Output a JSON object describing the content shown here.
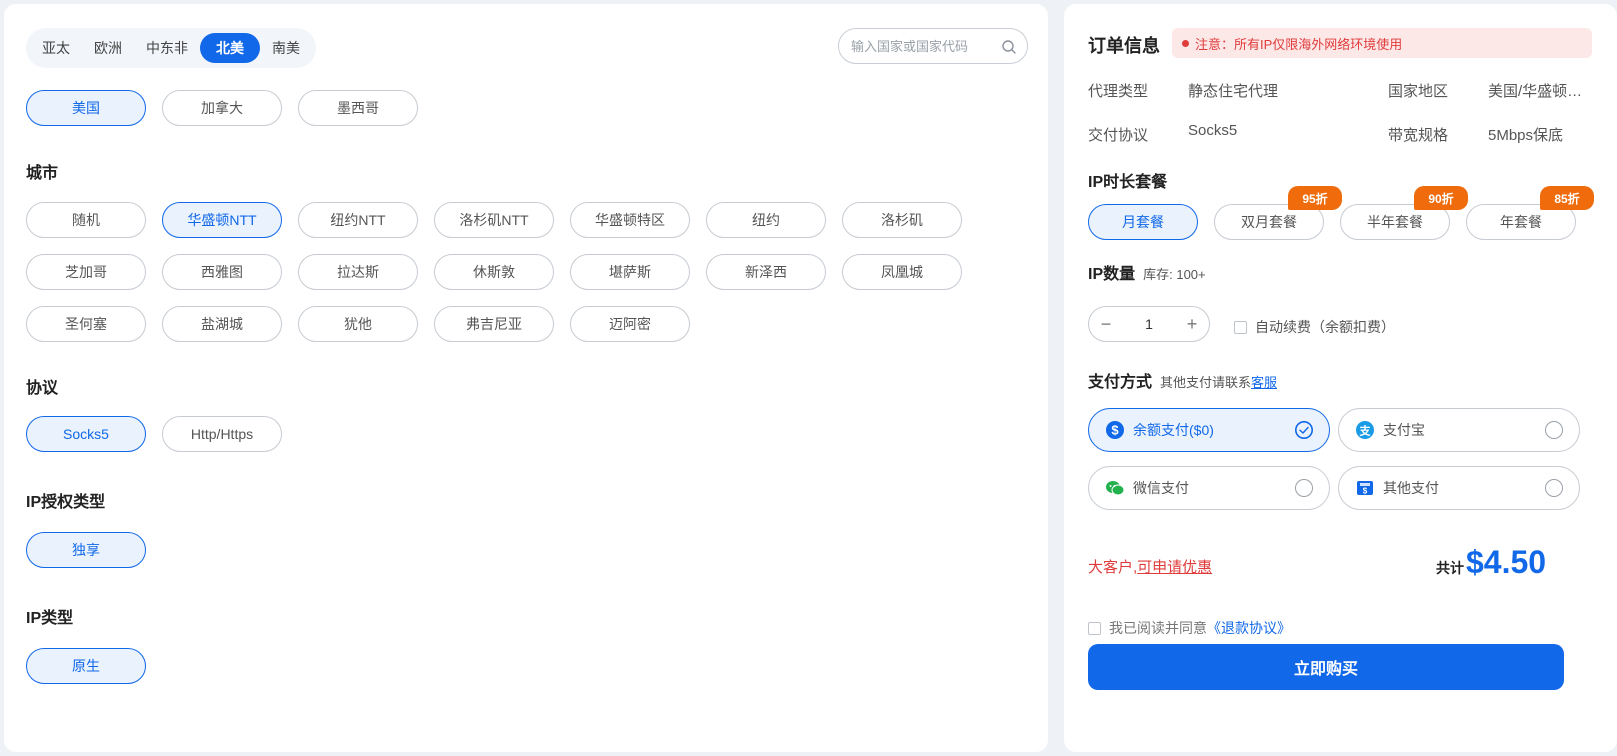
{
  "regions": [
    "亚太",
    "欧洲",
    "中东非",
    "北美",
    "南美"
  ],
  "search": {
    "placeholder": "输入国家或国家代码"
  },
  "countries": [
    "美国",
    "加拿大",
    "墨西哥"
  ],
  "city": {
    "title": "城市",
    "row1": [
      "随机",
      "华盛顿NTT",
      "纽约NTT",
      "洛杉矶NTT",
      "华盛顿特区",
      "纽约",
      "洛杉矶"
    ],
    "row2": [
      "芝加哥",
      "西雅图",
      "拉达斯",
      "休斯敦",
      "堪萨斯",
      "新泽西",
      "凤凰城"
    ],
    "row3": [
      "圣何塞",
      "盐湖城",
      "犹他",
      "弗吉尼亚",
      "迈阿密"
    ]
  },
  "protocol": {
    "title": "协议",
    "options": [
      "Socks5",
      "Http/Https"
    ]
  },
  "auth": {
    "title": "IP授权类型",
    "options": [
      "独享"
    ]
  },
  "iptype": {
    "title": "IP类型",
    "options": [
      "原生"
    ]
  },
  "order": {
    "title": "订单信息",
    "notice": "注意：所有IP仅限海外网络环境使用",
    "proxy_type_label": "代理类型",
    "proxy_type_value": "静态住宅代理",
    "region_label": "国家地区",
    "region_value": "美国/华盛顿NTT",
    "delivery_label": "交付协议",
    "delivery_value": "Socks5",
    "bandwidth_label": "带宽规格",
    "bandwidth_value": "5Mbps保底"
  },
  "packages": {
    "title": "IP时长套餐",
    "items": [
      {
        "label": "月套餐",
        "badge": ""
      },
      {
        "label": "双月套餐",
        "badge": "95折"
      },
      {
        "label": "半年套餐",
        "badge": "90折"
      },
      {
        "label": "年套餐",
        "badge": "85折"
      }
    ]
  },
  "quantity": {
    "title": "IP数量",
    "stock": "库存: 100+",
    "value": "1",
    "minus": "−",
    "plus": "+",
    "auto_renew": "自动续费（余额扣费）"
  },
  "payment": {
    "title": "支付方式",
    "note": "其他支付请联系",
    "contact": "客服",
    "methods": [
      "余额支付($0)",
      "支付宝",
      "微信支付",
      "其他支付"
    ]
  },
  "promo": {
    "prefix": "大客户,",
    "link": "可申请优惠"
  },
  "total": {
    "label": "共计",
    "amount": "$4.50"
  },
  "agree": {
    "text": "我已阅读并同意",
    "link": "《退款协议》"
  },
  "buy_button": "立即购买",
  "colors": {
    "accent": "#1168e8",
    "badge": "#ef6b0c",
    "warning": "#e03b3b"
  }
}
